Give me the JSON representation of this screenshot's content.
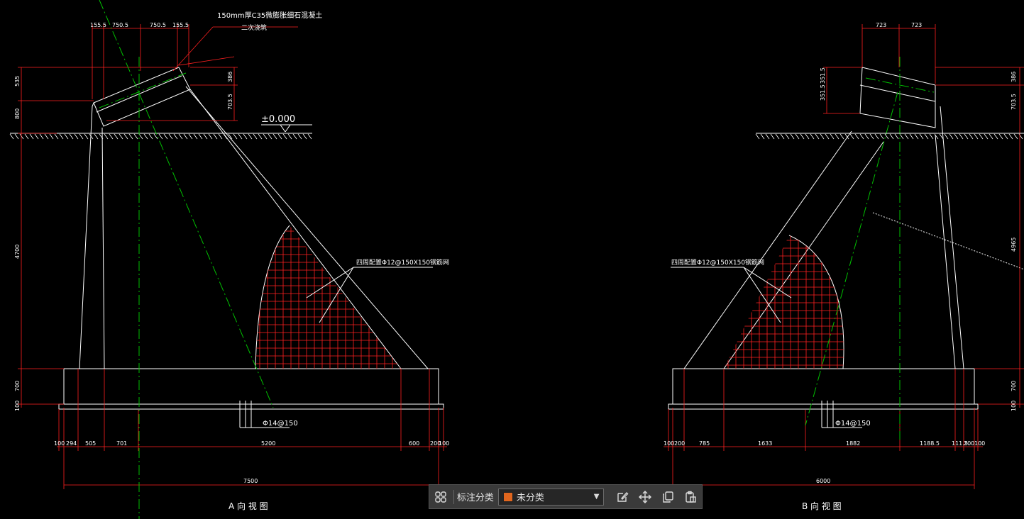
{
  "drawing": {
    "view_a_title": "A 向 视 图",
    "view_b_title": "B 向 视 图",
    "elevation_label": "±0.000",
    "note_concrete": "150mm厚C35微膨胀细石混凝土",
    "note_concrete_2": "二次浇筑",
    "note_rebar_a": "四周配置Φ12@150X150钢筋网",
    "note_rebar_b": "四周配置Φ12@150X150钢筋网",
    "rebar_a": "Φ14@150",
    "rebar_b": "Φ14@150",
    "dims_a_top": [
      "155.5",
      "750.5",
      "750.5",
      "155.5"
    ],
    "dims_a_left": [
      "535",
      "800",
      "4700",
      "700",
      "100"
    ],
    "dims_a_right": [
      "386",
      "703.5"
    ],
    "dims_a_bottom": [
      "100",
      "294",
      "505",
      "701",
      "5200",
      "600",
      "200",
      "100"
    ],
    "dims_a_total": "7500",
    "dims_b_top": [
      "723",
      "723"
    ],
    "dims_b_left": [
      "351.5",
      "351.5"
    ],
    "dims_b_right": [
      "386",
      "703.5",
      "4965",
      "700",
      "100"
    ],
    "dims_b_bottom": [
      "100",
      "200",
      "785",
      "1633",
      "1882",
      "1188.5",
      "111.5",
      "200",
      "100"
    ],
    "dims_b_total": "6000",
    "colors": {
      "line": "#ffffff",
      "dim": "#ff2020",
      "center": "#00c000",
      "background": "#000000"
    }
  },
  "toolbar": {
    "label": "标注分类",
    "select_value": "未分类",
    "select_color": "#e0661e",
    "icons": [
      "grid-icon",
      "edit-icon",
      "move-icon",
      "copy-icon",
      "paste-icon"
    ]
  }
}
